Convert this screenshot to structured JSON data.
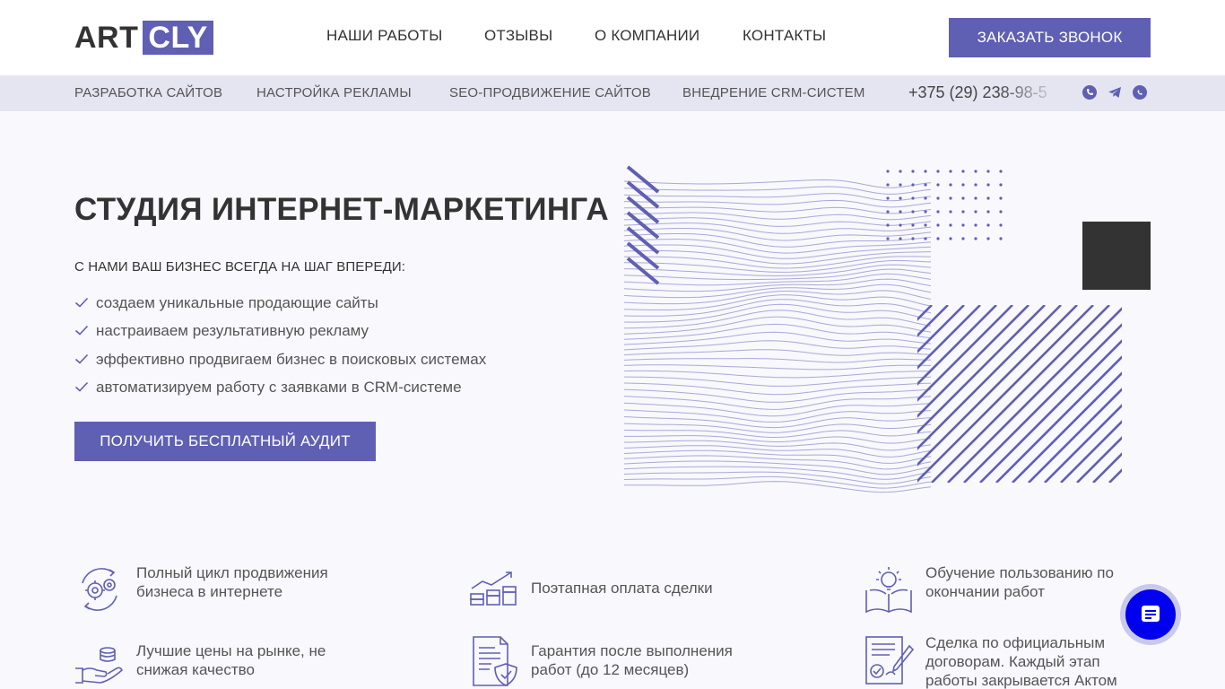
{
  "logo": {
    "part1": "ART",
    "part2": "CLY"
  },
  "nav": [
    {
      "label": "НАШИ РАБОТЫ"
    },
    {
      "label": "ОТЗЫВЫ"
    },
    {
      "label": "О КОМПАНИИ"
    },
    {
      "label": "КОНТАКТЫ"
    }
  ],
  "header": {
    "cta_label": "ЗАКАЗАТЬ ЗВОНОК"
  },
  "services": [
    {
      "label": "РАЗРАБОТКА САЙТОВ"
    },
    {
      "label": "НАСТРОЙКА РЕКЛАМЫ"
    },
    {
      "label": "SEO-ПРОДВИЖЕНИЕ САЙТОВ"
    },
    {
      "label": "ВНЕДРЕНИЕ CRM-СИСТЕМ"
    }
  ],
  "contact": {
    "phone": "+375 (29) 238-98-5",
    "social": [
      "viber-icon",
      "telegram-icon",
      "whatsapp-icon"
    ]
  },
  "hero": {
    "title": "СТУДИЯ ИНТЕРНЕТ-МАРКЕТИНГА",
    "subtitle": "С НАМИ ВАШ БИЗНЕС ВСЕГДА НА ШАГ ВПЕРЕДИ:",
    "points": [
      "создаем уникальные продающие сайты",
      "настраиваем результативную рекламу",
      "эффективно продвигаем бизнес в поисковых системах",
      "автоматизируем работу с заявками в CRM-системе"
    ],
    "cta_label": "ПОЛУЧИТЬ БЕСПЛАТНЫЙ АУДИТ"
  },
  "features": [
    {
      "icon": "gears-cycle-icon",
      "text": "Полный цикл продвижения бизнеса в интернете"
    },
    {
      "icon": "growth-chart-icon",
      "text": "Поэтапная оплата сделки"
    },
    {
      "icon": "book-lightbulb-icon",
      "text": "Обучение пользованию по окончании работ"
    },
    {
      "icon": "hand-coins-icon",
      "text": "Лучшие цены на рынке, не снижая качество"
    },
    {
      "icon": "document-shield-icon",
      "text": "Гарантия после выполнения работ (до 12 месяцев)"
    },
    {
      "icon": "contract-signature-icon",
      "text": "Сделка по официальным договорам. Каждый этап работы закрывается Актом"
    }
  ],
  "colors": {
    "accent": "#5f5fb4",
    "dark": "#333333",
    "subbar": "#e5e5f2",
    "chat_button": "#0000ee"
  }
}
